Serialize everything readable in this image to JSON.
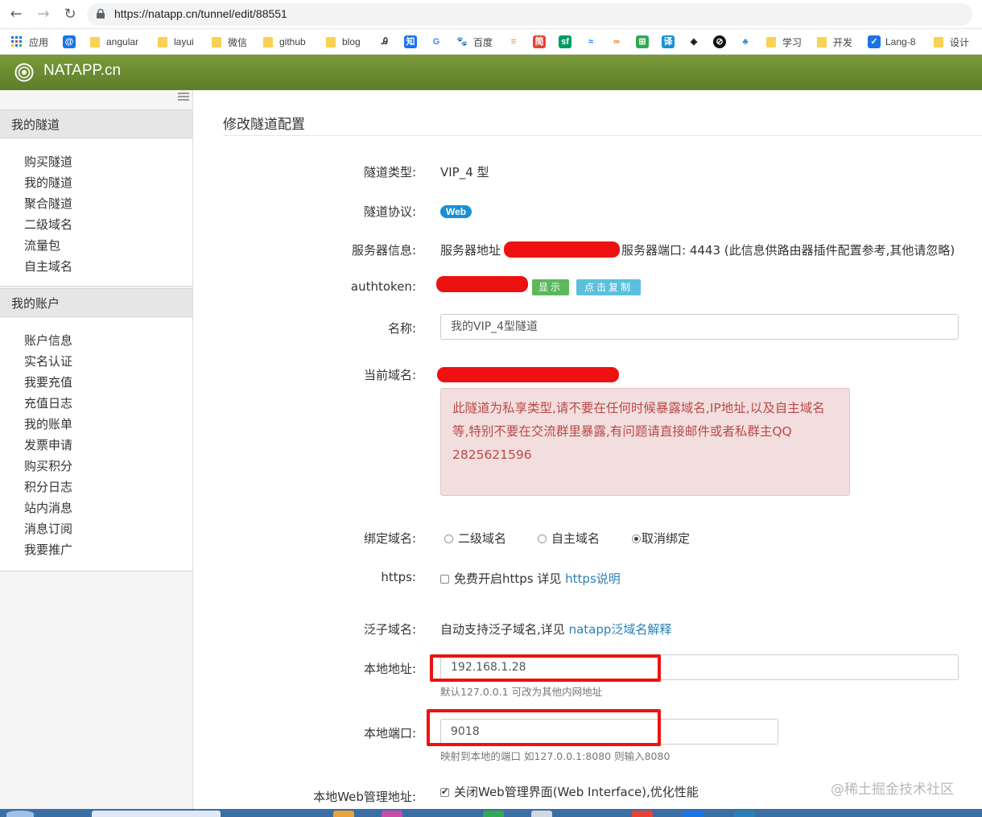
{
  "browser": {
    "url": "https://natapp.cn/tunnel/edit/88551",
    "bookmarks": [
      "应用",
      "angular",
      "layui",
      "微信",
      "github",
      "blog",
      "百度",
      "学习",
      "开发",
      "Lang-8",
      "设计"
    ]
  },
  "site": {
    "name": "NATAPP.cn"
  },
  "sidebar": {
    "section1": {
      "title": "我的隧道",
      "items": [
        "购买隧道",
        "我的隧道",
        "聚合隧道",
        "二级域名",
        "流量包",
        "自主域名"
      ]
    },
    "section2": {
      "title": "我的账户",
      "items": [
        "账户信息",
        "实名认证",
        "我要充值",
        "充值日志",
        "我的账单",
        "发票申请",
        "购买积分",
        "积分日志",
        "站内消息",
        "消息订阅",
        "我要推广"
      ]
    }
  },
  "main": {
    "title": "修改隧道配置",
    "tunnel_type": {
      "label": "隧道类型:",
      "value": "VIP_4 型"
    },
    "protocol": {
      "label": "隧道协议:",
      "value": "Web"
    },
    "server": {
      "label": "服务器信息:",
      "prefix": "服务器地址",
      "suffix": "服务器端口: 4443 (此信息供路由器插件配置参考,其他请忽略)"
    },
    "authtoken": {
      "label": "authtoken:",
      "show_button": "显示",
      "copy_button": "点击复制"
    },
    "name": {
      "label": "名称:",
      "value": "我的VIP_4型隧道"
    },
    "domain": {
      "label": "当前域名:",
      "alert": "此隧道为私享类型,请不要在任何时候暴露域名,IP地址,以及自主域名等,特别不要在交流群里暴露,有问题请直接邮件或者私群主QQ 2825621596"
    },
    "bind": {
      "label": "绑定域名:",
      "options": [
        "二级域名",
        "自主域名",
        "取消绑定"
      ],
      "selected": "取消绑定"
    },
    "https": {
      "label": "https:",
      "text": "免费开启https 详见",
      "link": "https说明"
    },
    "wildcard": {
      "label": "泛子域名:",
      "text": "自动支持泛子域名,详见",
      "link": "natapp泛域名解释"
    },
    "local_addr": {
      "label": "本地地址:",
      "value": "192.168.1.28",
      "hint": "默认127.0.0.1 可改为其他内网地址"
    },
    "local_port": {
      "label": "本地端口:",
      "value": "9018",
      "hint": "映射到本地的端口 如127.0.0.1:8080 则输入8080"
    },
    "web_admin": {
      "label": "本地Web管理地址:",
      "text": "关闭Web管理界面(Web Interface),优化性能"
    }
  },
  "watermark": "@稀土掘金技术社区",
  "colors": {
    "header_green": "#6b8b30",
    "badge_blue": "#1a8fd1",
    "alert_bg": "#f2dede",
    "alert_text": "#b94a48",
    "annotation_red": "#ee1111",
    "link": "#2a7fb8"
  }
}
